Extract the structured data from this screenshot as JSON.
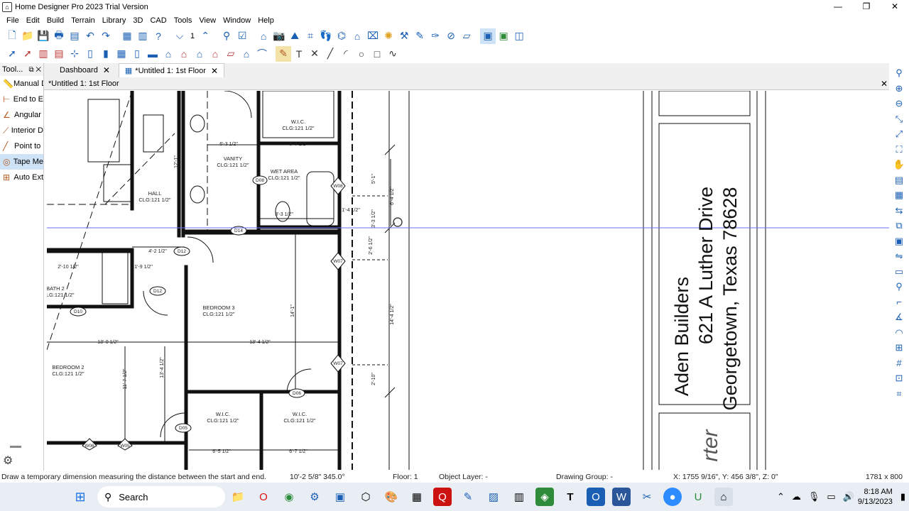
{
  "window": {
    "title": "Home Designer Pro 2023 Trial Version",
    "app_icon": "home-designer-icon",
    "controls": [
      "minimize-icon",
      "maximize-icon",
      "close-icon"
    ]
  },
  "menu": [
    "File",
    "Edit",
    "Build",
    "Terrain",
    "Library",
    "3D",
    "CAD",
    "Tools",
    "View",
    "Window",
    "Help"
  ],
  "toolbar": {
    "floor_value": "1"
  },
  "left_panel": {
    "title": "Tool...",
    "items": [
      {
        "label": "Manual D",
        "icon": "ruler-icon"
      },
      {
        "label": "End to E",
        "icon": "end-to-end-dimension-icon"
      },
      {
        "label": "Angular",
        "icon": "angular-dimension-icon"
      },
      {
        "label": "Interior D",
        "icon": "interior-dimension-icon"
      },
      {
        "label": "Point to",
        "icon": "point-to-point-icon"
      },
      {
        "label": "Tape Me",
        "icon": "tape-measure-icon"
      },
      {
        "label": "Auto Ext",
        "icon": "auto-exterior-dimension-icon"
      }
    ]
  },
  "tabs": [
    {
      "label": "Dashboard",
      "active": false
    },
    {
      "label": "*Untitled 1: 1st Floor",
      "active": true
    }
  ],
  "drawing": {
    "header": "*Untitled 1: 1st Floor",
    "rooms": [
      "W.I.C.",
      "CLG:121 1/2\"",
      "VANITY",
      "WET AREA",
      "HALL",
      "BATH 2",
      "BEDROOM 3",
      "BEDROOM 2"
    ],
    "title_block": {
      "line1": "Aden Builders",
      "line2": "621 A Luther Drive",
      "line3": "Georgetown, Texas 78628",
      "partial": "rter"
    },
    "dims": [
      "6'-3 1/2\"",
      "6'-7 1/2\"",
      "12'-1\"",
      "4'-2 1/2\"",
      "2'-10 1/2\"",
      "1'-9 1/2\"",
      "13'-0 1/2\"",
      "13'-4 1/2\"",
      "14'-1\"",
      "11'-7 1/2\"",
      "6'-5 1/2\"",
      "6'-7 1/2\"",
      "14'-4 1/2\"",
      "5'-1\"",
      "6'-4 1/2\"",
      "3'-3 1/2\"",
      "2'-6 1/2\"",
      "2'-10\"",
      "1'-4 1/2\""
    ],
    "tags": [
      "D14",
      "D12",
      "D10",
      "D08",
      "D06",
      "D05",
      "D12",
      "W08",
      "W07",
      "W07",
      "W06",
      "W05"
    ]
  },
  "status": {
    "hint": "Draw a temporary dimension measuring the distance between the start and end.",
    "measure": "10'-2 5/8\" 345.0°",
    "floor": "Floor: 1",
    "layer": "Object Layer: -",
    "group": "Drawing Group: -",
    "coords": "X: 1755 9/16\", Y: 456 3/8\", Z: 0\"",
    "size": "1781 x 800"
  },
  "taskbar": {
    "search": "Search",
    "time": "8:18 AM",
    "date": "9/13/2023"
  }
}
